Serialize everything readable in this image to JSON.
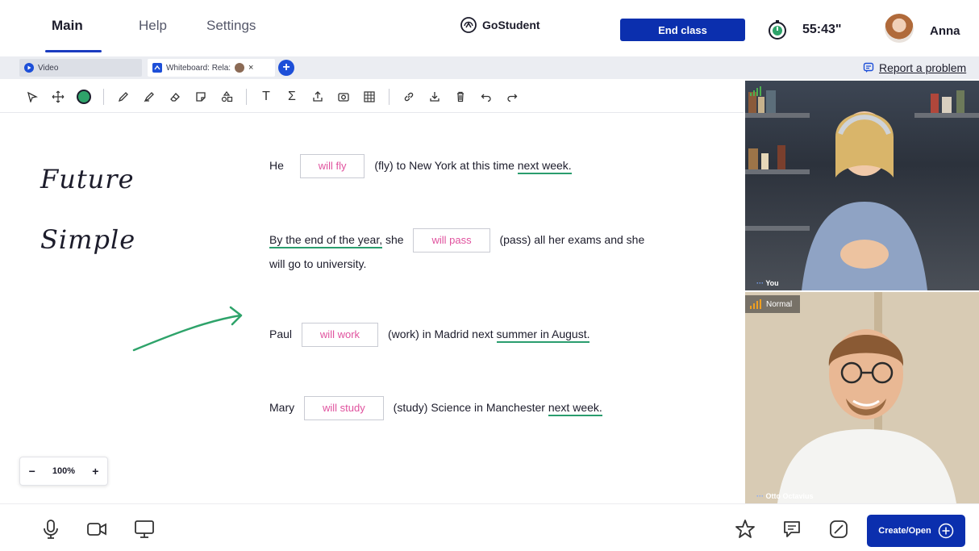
{
  "nav": {
    "tabs": [
      "Main",
      "Help",
      "Settings"
    ]
  },
  "brand": {
    "name": "GoStudent"
  },
  "header": {
    "end_class_label": "End class",
    "timer": "55:43\"",
    "user_name": "Anna"
  },
  "doc_tabs": {
    "video_label": "Video",
    "whiteboard_label": "Whiteboard: Rela:",
    "add_symbol": "+"
  },
  "report": {
    "label": "Report a problem"
  },
  "board": {
    "handwriting_1": "Future",
    "handwriting_2": "Simple",
    "sentences": [
      {
        "pre": "He",
        "answer": "will fly",
        "post": "(fly) to New York at this time",
        "underlined": "next week."
      },
      {
        "underlined_pre": "By the end of the year,",
        "pre": "she",
        "answer": "will pass",
        "post": "(pass) all her exams and she",
        "line2": "will go to university."
      },
      {
        "pre": "Paul",
        "answer": "will work",
        "post": "(work) in Madrid next",
        "underlined": "summer in August."
      },
      {
        "pre": "Mary",
        "answer": "will study",
        "post": "(study) Science in Manchester",
        "underlined": "next week."
      }
    ],
    "zoom": {
      "minus": "−",
      "value": "100%",
      "plus": "+"
    }
  },
  "videos": {
    "you_label": "You",
    "otto_label": "Otto Octavius",
    "quality_label": "Normal"
  },
  "bottom": {
    "create_label": "Create/Open"
  },
  "colors": {
    "accent": "#0b2fae",
    "answer_text": "#e0529e",
    "underline": "#2a9d6e",
    "pen_green": "#2ea36a"
  }
}
